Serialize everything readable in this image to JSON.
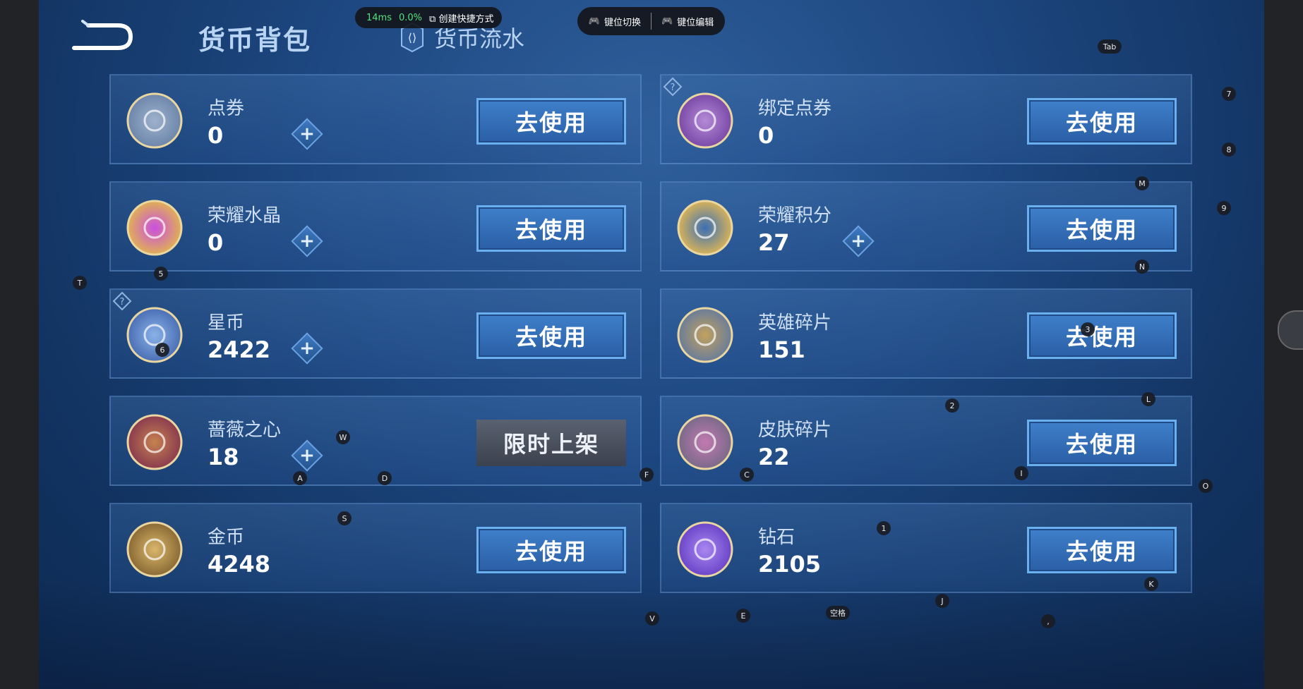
{
  "header": {
    "title": "货币背包",
    "flow_tab": "货币流水"
  },
  "overlay": {
    "ms": "14ms",
    "pct": "0.0%",
    "shortcut": "创建快捷方式",
    "key_switch": "键位切换",
    "key_edit": "键位编辑"
  },
  "currencies": [
    {
      "name": "点券",
      "value": "0",
      "plus": true,
      "action": "去使用"
    },
    {
      "name": "绑定点券",
      "value": "0",
      "plus": false,
      "action": "去使用"
    },
    {
      "name": "荣耀水晶",
      "value": "0",
      "plus": true,
      "action": "去使用"
    },
    {
      "name": "荣耀积分",
      "value": "27",
      "plus": true,
      "action": "去使用"
    },
    {
      "name": "星币",
      "value": "2422",
      "plus": true,
      "action": "去使用"
    },
    {
      "name": "英雄碎片",
      "value": "151",
      "plus": false,
      "action": "去使用"
    },
    {
      "name": "蔷薇之心",
      "value": "18",
      "plus": true,
      "action": "限时上架"
    },
    {
      "name": "皮肤碎片",
      "value": "22",
      "plus": false,
      "action": "去使用"
    },
    {
      "name": "金币",
      "value": "4248",
      "plus": false,
      "action": "去使用"
    },
    {
      "name": "钻石",
      "value": "2105",
      "plus": false,
      "action": "去使用"
    }
  ],
  "plus_symbol": "+",
  "key_hints": [
    "Tab",
    "7",
    "8",
    "M",
    "9",
    "N",
    "5",
    "T",
    "6",
    "3",
    "2",
    "L",
    "W",
    "A",
    "D",
    "F",
    "C",
    "I",
    "O",
    "S",
    "1",
    "K",
    "J",
    "V",
    "E",
    "空格",
    ","
  ]
}
